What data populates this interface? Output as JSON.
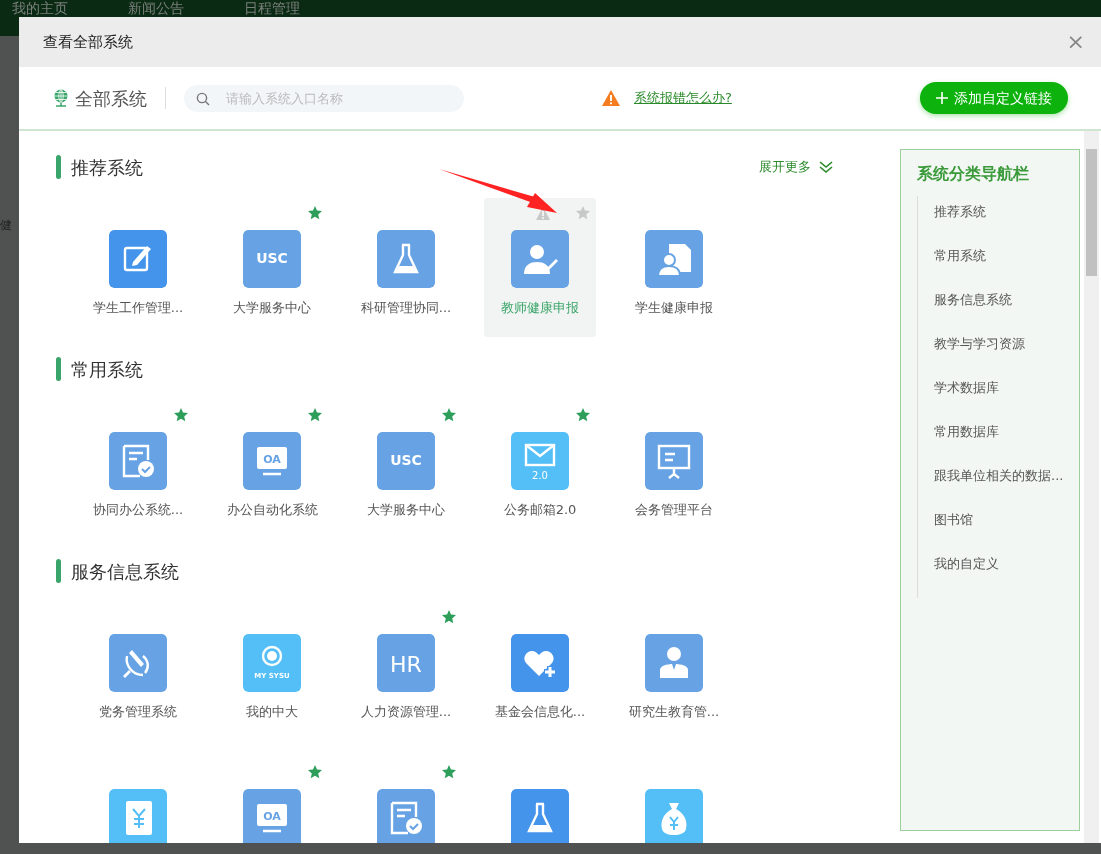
{
  "background_nav": [
    "我的主页",
    "新闻公告",
    "日程管理"
  ],
  "background_side_text": "健",
  "modal": {
    "title": "查看全部系统",
    "close": "×"
  },
  "toolbar": {
    "scope": "全部系统",
    "search": {
      "placeholder": "请输入系统入口名称"
    },
    "help_link": "系统报错怎么办?",
    "add_button": "添加自定义链接"
  },
  "expand_more": "展开更多",
  "sections": [
    {
      "title": "推荐系统",
      "tiles": [
        {
          "name": "学生工作管理...",
          "kind": "edit",
          "color": "#4394ea",
          "starred": false,
          "hovered": false
        },
        {
          "name": "大学服务中心",
          "kind": "text",
          "icon_text": "USC",
          "color": "#67a3e4",
          "starred": true,
          "hovered": false
        },
        {
          "name": "科研管理协同...",
          "kind": "flask",
          "color": "#67a3e4",
          "starred": false,
          "hovered": false
        },
        {
          "name": "教师健康申报",
          "kind": "person",
          "color": "#67a3e4",
          "starred": false,
          "hovered": true
        },
        {
          "name": "学生健康申报",
          "kind": "doc-person",
          "color": "#67a3e4",
          "starred": false,
          "hovered": false
        }
      ]
    },
    {
      "title": "常用系统",
      "tiles": [
        {
          "name": "协同办公系统...",
          "kind": "doc-check",
          "color": "#67a3e4",
          "starred": true,
          "hovered": false
        },
        {
          "name": "办公自动化系统",
          "kind": "monitor",
          "icon_text": "OA",
          "color": "#67a3e4",
          "starred": true,
          "hovered": false
        },
        {
          "name": "大学服务中心",
          "kind": "text",
          "icon_text": "USC",
          "color": "#67a3e4",
          "starred": true,
          "hovered": false
        },
        {
          "name": "公务邮箱2.0",
          "kind": "mail",
          "icon_text": "2.0",
          "color": "#54bff7",
          "starred": true,
          "hovered": false
        },
        {
          "name": "会务管理平台",
          "kind": "board",
          "color": "#67a3e4",
          "starred": false,
          "hovered": false
        }
      ]
    },
    {
      "title": "服务信息系统",
      "tiles": [
        {
          "name": "党务管理系统",
          "kind": "emblem",
          "color": "#67a3e4",
          "starred": false,
          "hovered": false
        },
        {
          "name": "我的中大",
          "kind": "seal",
          "icon_text": "MY SYSU",
          "color": "#54bff7",
          "starred": false,
          "hovered": false
        },
        {
          "name": "人力资源管理...",
          "kind": "text",
          "icon_text": "HR",
          "color": "#67a3e4",
          "starred": true,
          "hovered": false
        },
        {
          "name": "基金会信息化...",
          "kind": "heart",
          "color": "#4394ea",
          "starred": false,
          "hovered": false
        },
        {
          "name": "研究生教育管...",
          "kind": "user",
          "color": "#67a3e4",
          "starred": false,
          "hovered": false
        },
        {
          "kind": "notebook",
          "color": "#54bff7",
          "starred": false,
          "hovered": false
        },
        {
          "kind": "monitor",
          "icon_text": "OA",
          "color": "#67a3e4",
          "starred": true,
          "hovered": false
        },
        {
          "kind": "doc-check",
          "color": "#67a3e4",
          "starred": true,
          "hovered": false
        },
        {
          "kind": "flask",
          "color": "#4394ea",
          "starred": false,
          "hovered": false
        },
        {
          "kind": "moneybag",
          "color": "#54bff7",
          "starred": false,
          "hovered": false
        }
      ]
    }
  ],
  "sidebar": {
    "title": "系统分类导航栏",
    "items": [
      "推荐系统",
      "常用系统",
      "服务信息系统",
      "教学与学习资源",
      "学术数据库",
      "常用数据库",
      "跟我单位相关的数据...",
      "图书馆",
      "我的自定义"
    ]
  }
}
